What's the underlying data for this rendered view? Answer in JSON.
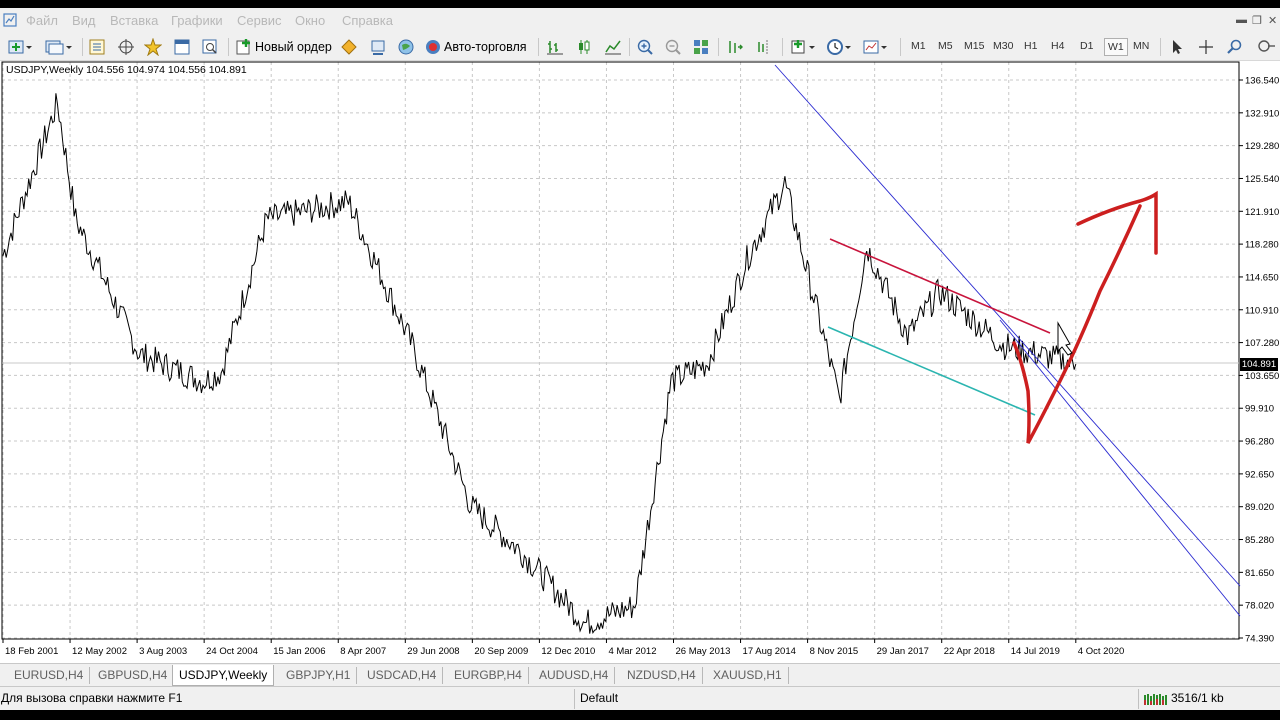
{
  "menu": {
    "items": [
      "Файл",
      "Вид",
      "Вставка",
      "Графики",
      "Сервис",
      "Окно",
      "Справка"
    ]
  },
  "toolbar": {
    "new_order": "Новый ордер",
    "auto_trading": "Авто-торговля",
    "timeframes": [
      "M1",
      "M5",
      "M15",
      "M30",
      "H1",
      "H4",
      "D1",
      "W1",
      "MN"
    ],
    "active_timeframe": "W1"
  },
  "chart": {
    "symbol_info": "USDJPY,Weekly  104.556 104.974 104.556 104.891",
    "current_price": "104.891",
    "price_labels": [
      "136.540",
      "132.910",
      "129.280",
      "125.540",
      "121.910",
      "118.280",
      "114.650",
      "110.910",
      "107.280",
      "103.650",
      "99.910",
      "96.280",
      "92.650",
      "89.020",
      "85.280",
      "81.650",
      "78.020",
      "74.390"
    ],
    "date_labels": [
      "18 Feb 2001",
      "12 May 2002",
      "3 Aug 2003",
      "24 Oct 2004",
      "15 Jan 2006",
      "8 Apr 2007",
      "29 Jun 2008",
      "20 Sep 2009",
      "12 Dec 2010",
      "4 Mar 2012",
      "26 May 2013",
      "17 Aug 2014",
      "8 Nov 2015",
      "29 Jan 2017",
      "22 Apr 2018",
      "14 Jul 2019",
      "4 Oct 2020"
    ]
  },
  "chart_data": {
    "type": "line",
    "series": [
      {
        "x": [
          "2001-02",
          "2002-02",
          "2002-06",
          "2003-08",
          "2004-10",
          "2005-02",
          "2005-12",
          "2007-06",
          "2008-08",
          "2009-09",
          "2010-08",
          "2011-10",
          "2012-09",
          "2013-05",
          "2014-01",
          "2014-10",
          "2015-06",
          "2016-06",
          "2016-12",
          "2017-09",
          "2018-04",
          "2019-06",
          "2020-10"
        ],
        "values": [
          117,
          134,
          121,
          106,
          103,
          104,
          121,
          123,
          107,
          89,
          84,
          76,
          78,
          103,
          105,
          117,
          125,
          101,
          118,
          108,
          113,
          107,
          104.9
        ]
      }
    ],
    "ylim": [
      74.39,
      138
    ]
  },
  "tabs": [
    "EURUSD,H4",
    "GBPUSD,H4",
    "USDJPY,Weekly",
    "GBPJPY,H1",
    "USDCAD,H4",
    "EURGBP,H4",
    "AUDUSD,H4",
    "NZDUSD,H4",
    "XAUUSD,H1"
  ],
  "active_tab": "USDJPY,Weekly",
  "status": {
    "help": "Для вызова справки нажмите F1",
    "profile": "Default",
    "traffic": "3516/1 kb"
  },
  "colors": {
    "trend_upper": "#c8143c",
    "trend_lower": "#2bb5b0",
    "channel": "#2a2ad0",
    "arrow": "#cc1f1f"
  }
}
